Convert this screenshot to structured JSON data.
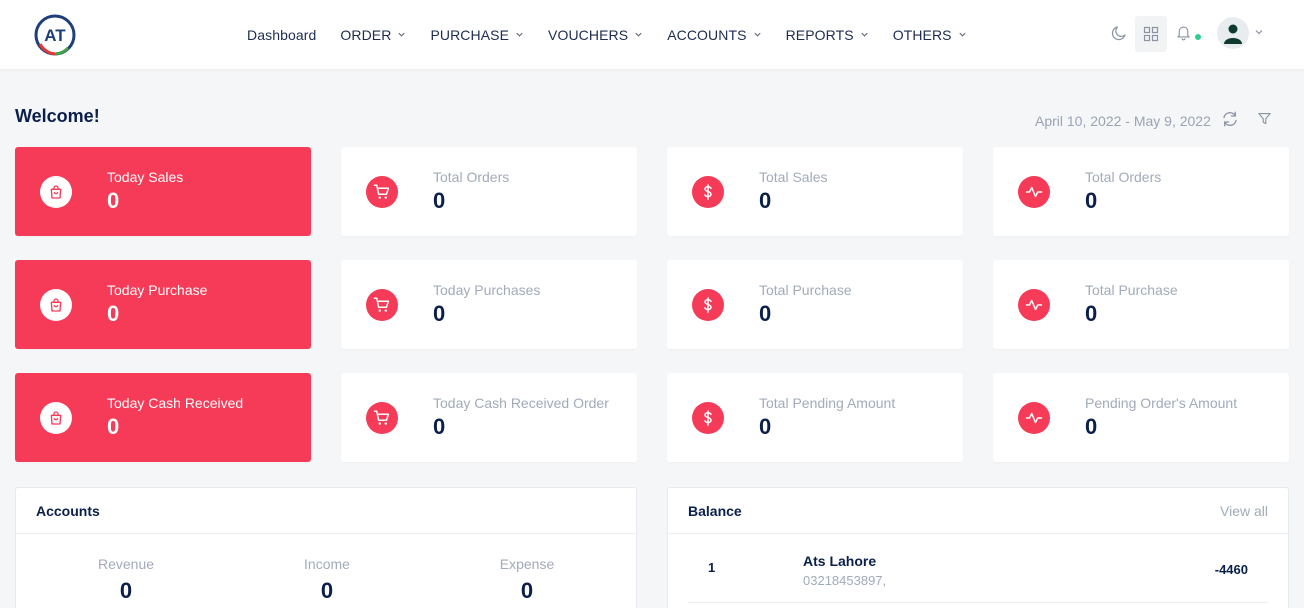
{
  "brand": {
    "logo_text": "AT"
  },
  "nav": [
    {
      "label": "Dashboard",
      "has_dropdown": false
    },
    {
      "label": "ORDER",
      "has_dropdown": true
    },
    {
      "label": "PURCHASE",
      "has_dropdown": true
    },
    {
      "label": "VOUCHERS",
      "has_dropdown": true
    },
    {
      "label": "ACCOUNTS",
      "has_dropdown": true
    },
    {
      "label": "REPORTS",
      "has_dropdown": true
    },
    {
      "label": "OTHERS",
      "has_dropdown": true
    }
  ],
  "header_icons": [
    "moon-icon",
    "apps-grid-icon",
    "bell-icon",
    "user-avatar-icon",
    "chevron-down-icon"
  ],
  "welcome": {
    "title": "Welcome!",
    "date_range": "April 10, 2022 - May 9, 2022"
  },
  "cards": [
    {
      "label": "Today Sales",
      "value": "0",
      "icon": "bag-icon",
      "variant": "red"
    },
    {
      "label": "Total Orders",
      "value": "0",
      "icon": "cart-icon",
      "variant": "white"
    },
    {
      "label": "Total Sales",
      "value": "0",
      "icon": "dollar-icon",
      "variant": "white"
    },
    {
      "label": "Total Orders",
      "value": "0",
      "icon": "activity-icon",
      "variant": "white"
    },
    {
      "label": "Today Purchase",
      "value": "0",
      "icon": "bag-icon",
      "variant": "red"
    },
    {
      "label": "Today Purchases",
      "value": "0",
      "icon": "cart-icon",
      "variant": "white"
    },
    {
      "label": "Total Purchase",
      "value": "0",
      "icon": "dollar-icon",
      "variant": "white"
    },
    {
      "label": "Total Purchase",
      "value": "0",
      "icon": "activity-icon",
      "variant": "white"
    },
    {
      "label": "Today Cash Received",
      "value": "0",
      "icon": "bag-icon",
      "variant": "red"
    },
    {
      "label": "Today Cash Received Order",
      "value": "0",
      "icon": "cart-icon",
      "variant": "white"
    },
    {
      "label": "Total Pending Amount",
      "value": "0",
      "icon": "dollar-icon",
      "variant": "white"
    },
    {
      "label": "Pending Order's Amount",
      "value": "0",
      "icon": "activity-icon",
      "variant": "white"
    }
  ],
  "accounts": {
    "title": "Accounts",
    "columns": [
      {
        "label": "Revenue",
        "value": "0"
      },
      {
        "label": "Income",
        "value": "0"
      },
      {
        "label": "Expense",
        "value": "0"
      }
    ]
  },
  "balance": {
    "title": "Balance",
    "view_all": "View all",
    "rows": [
      {
        "index": "1",
        "name": "Ats Lahore",
        "phone": "03218453897,",
        "amount": "-4460"
      }
    ]
  },
  "colors": {
    "accent": "#f53b57",
    "text_dark": "#0b1f4b",
    "text_muted": "#a2abb9",
    "online_dot": "#2ecc8f"
  }
}
